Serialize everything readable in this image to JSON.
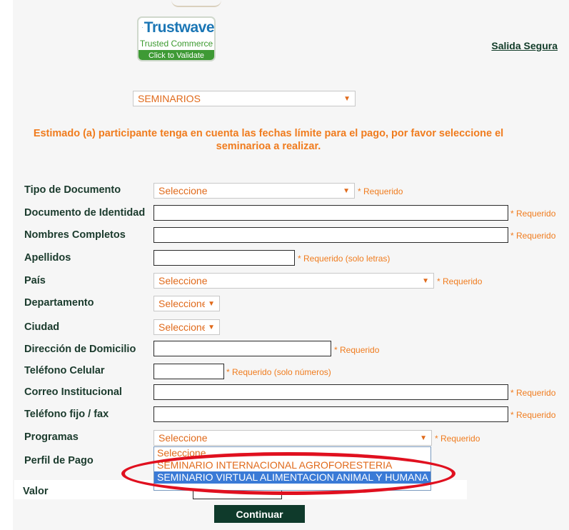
{
  "trustwave": {
    "brand": "Trustwave",
    "subtitle": "Trusted Commerce",
    "validate": "Click to Validate"
  },
  "header": {
    "logout_link": "Salida Segura"
  },
  "seminar_select": {
    "value": "SEMINARIOS"
  },
  "notice": "Estimado (a) participante tenga en cuenta las fechas límite para el pago, por favor seleccione el seminarioa a realizar.",
  "form": {
    "tipo_documento": {
      "label": "Tipo de Documento",
      "value": "Seleccione",
      "req": "* Requerido"
    },
    "documento": {
      "label": "Documento de Identidad",
      "req": "* Requerido"
    },
    "nombres": {
      "label": "Nombres Completos",
      "req": "* Requerido"
    },
    "apellidos": {
      "label": "Apellidos",
      "req": "* Requerido (solo letras)"
    },
    "pais": {
      "label": "País",
      "value": "Seleccione",
      "req": "* Requerido"
    },
    "departamento": {
      "label": "Departamento",
      "value": "Seleccione"
    },
    "ciudad": {
      "label": "Ciudad",
      "value": "Seleccione"
    },
    "direccion": {
      "label": "Dirección de Domicilio",
      "req": "* Requerido"
    },
    "celular": {
      "label": "Teléfono Celular",
      "req": "* Requerido (solo números)"
    },
    "correo": {
      "label": "Correo Institucional",
      "req": "* Requerido"
    },
    "telefono_fijo": {
      "label": "Teléfono fijo / fax",
      "req": "* Requerido"
    },
    "programas": {
      "label": "Programas",
      "value": "Seleccione",
      "req": "* Requerido"
    },
    "perfil_pago": {
      "label": "Perfil de Pago"
    },
    "valor": {
      "label": "Valor"
    }
  },
  "programas_options": [
    "Seleccione",
    "SEMINARIO INTERNACIONAL AGROFORESTERIA",
    "SEMINARIO VIRTUAL ALIMENTACION ANIMAL Y HUMANA"
  ],
  "continue_button": "Continuar",
  "colors": {
    "accent": "#f07c1e",
    "label": "#1a3a2c",
    "button": "#0f3a2b",
    "highlight": "#e0101f",
    "selected_option": "#3a7ad6"
  }
}
